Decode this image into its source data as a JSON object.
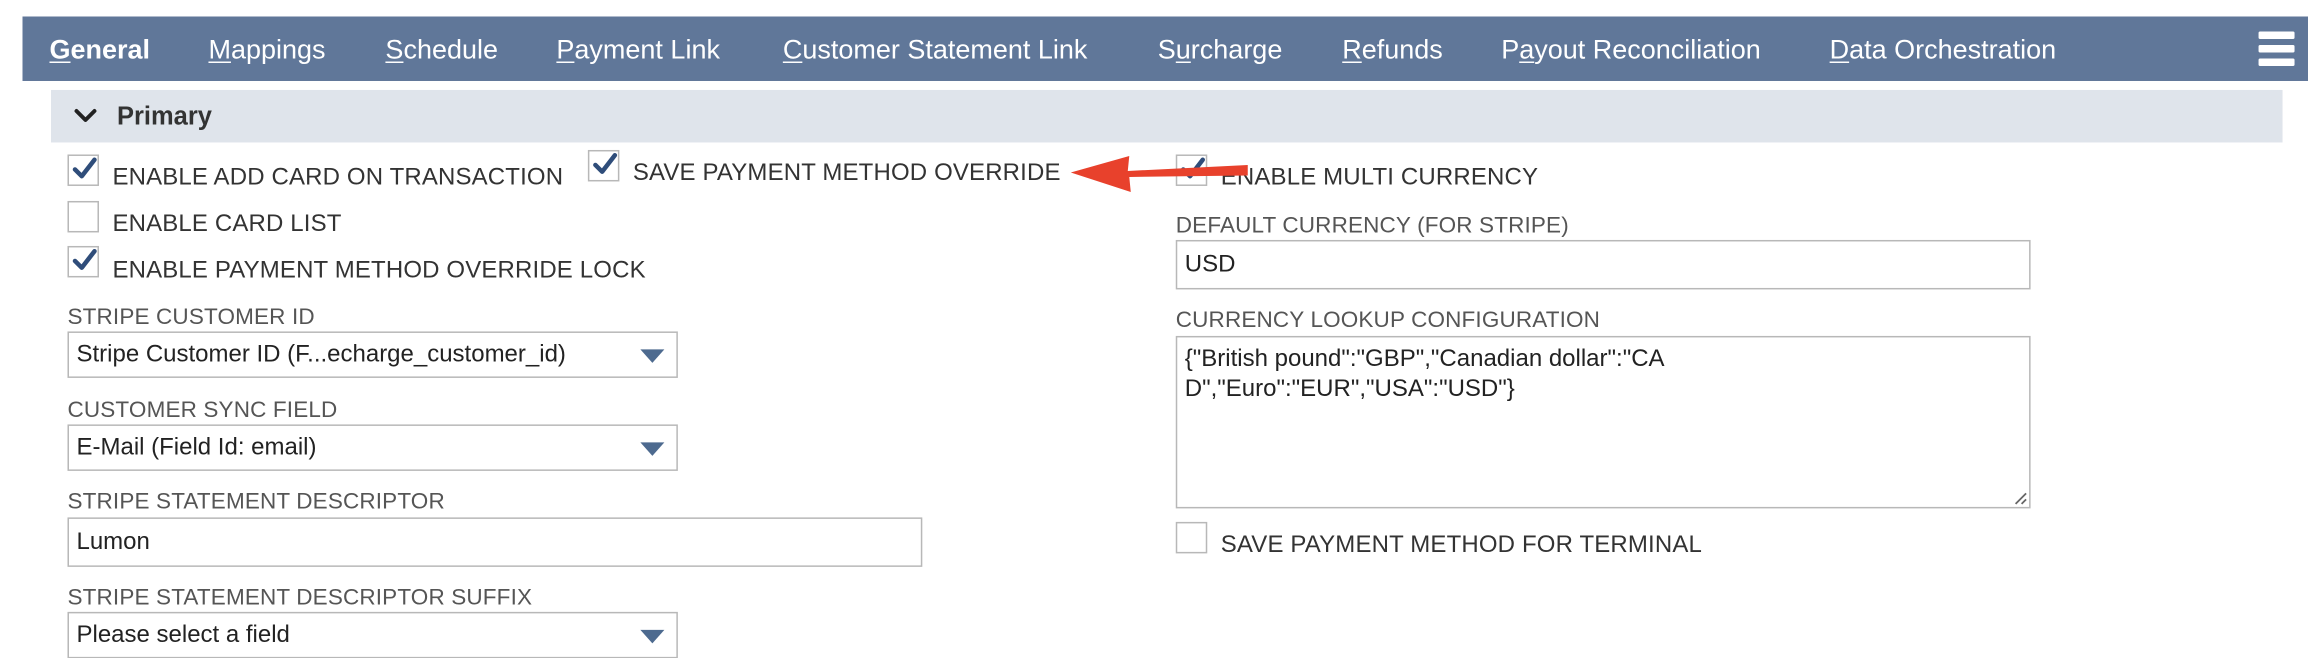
{
  "tabs": [
    {
      "u": "G",
      "rest": "eneral",
      "active": true
    },
    {
      "u": "M",
      "rest": "appings"
    },
    {
      "u": "S",
      "rest": "chedule"
    },
    {
      "u": "P",
      "rest": "ayment Link"
    },
    {
      "u": "C",
      "rest": "ustomer Statement Link"
    },
    {
      "pre": "S",
      "u": "u",
      "rest": "rcharge"
    },
    {
      "u": "R",
      "rest": "efunds"
    },
    {
      "pre": "P",
      "u": "a",
      "rest": "yout Reconciliation"
    },
    {
      "u": "D",
      "rest": "ata Orchestration"
    }
  ],
  "section": {
    "title": "Primary"
  },
  "checkboxes": {
    "add_card": {
      "label": "ENABLE ADD CARD ON TRANSACTION",
      "checked": true
    },
    "save_override": {
      "label": "SAVE PAYMENT METHOD OVERRIDE",
      "checked": true
    },
    "multi_currency": {
      "label": "ENABLE MULTI CURRENCY",
      "checked": true
    },
    "card_list": {
      "label": "ENABLE CARD LIST",
      "checked": false
    },
    "override_lock": {
      "label": "ENABLE PAYMENT METHOD OVERRIDE LOCK",
      "checked": true
    },
    "terminal": {
      "label": "SAVE PAYMENT METHOD FOR TERMINAL",
      "checked": false
    }
  },
  "fields": {
    "stripe_customer_id": {
      "label": "STRIPE CUSTOMER ID",
      "value": "Stripe Customer ID (F...echarge_customer_id)"
    },
    "customer_sync": {
      "label": "CUSTOMER SYNC FIELD",
      "value": "E-Mail (Field Id: email)"
    },
    "descriptor": {
      "label": "STRIPE STATEMENT DESCRIPTOR",
      "value": "Lumon"
    },
    "descriptor_suffix": {
      "label": "STRIPE STATEMENT DESCRIPTOR SUFFIX",
      "value": "Please select a field"
    },
    "default_currency": {
      "label": "DEFAULT CURRENCY (FOR STRIPE)",
      "value": "USD"
    },
    "currency_lookup": {
      "label": "CURRENCY LOOKUP CONFIGURATION",
      "value": "{\"British pound\":\"GBP\",\"Canadian dollar\":\"CAD\",\"Euro\":\"EUR\",\"USA\":\"USD\"}"
    }
  },
  "colors": {
    "tabbar": "#607799",
    "section": "#dfe4eb",
    "check": "#2f4d7a",
    "arrow": "#e8412c"
  }
}
